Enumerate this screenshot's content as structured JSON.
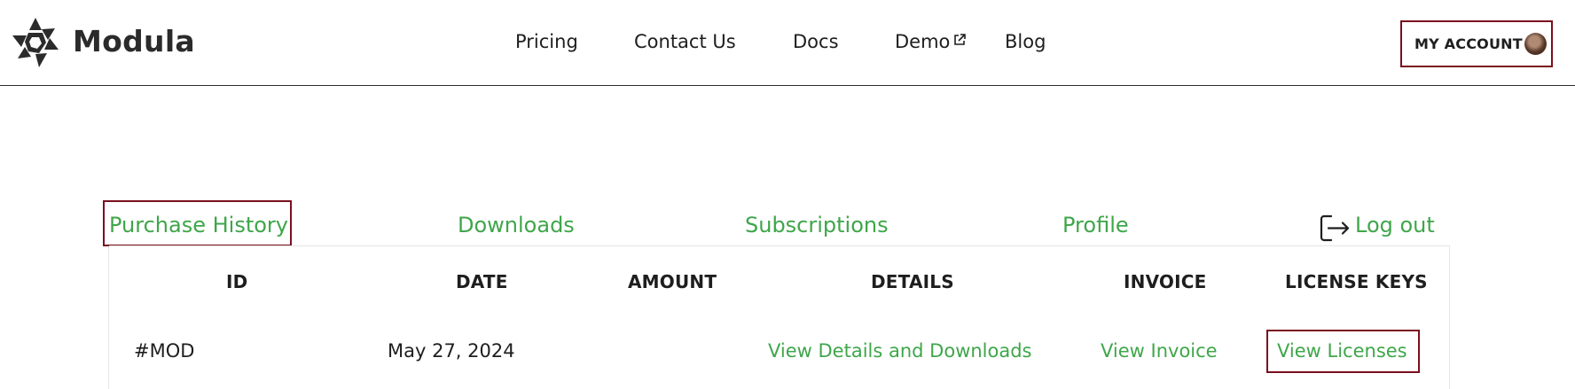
{
  "header": {
    "brand": "Modula",
    "nav": [
      {
        "label": "Pricing"
      },
      {
        "label": "Contact Us"
      },
      {
        "label": "Docs"
      },
      {
        "label": "Demo",
        "icon": "external-link-icon"
      },
      {
        "label": "Blog"
      }
    ],
    "account_label": "MY ACCOUNT"
  },
  "tabs": [
    {
      "label": "Purchase History",
      "active": true
    },
    {
      "label": "Downloads"
    },
    {
      "label": "Subscriptions"
    },
    {
      "label": "Profile"
    },
    {
      "label": "Log out",
      "icon": "logout-icon"
    }
  ],
  "table": {
    "columns": [
      "ID",
      "DATE",
      "AMOUNT",
      "DETAILS",
      "INVOICE",
      "LICENSE KEYS"
    ],
    "rows": [
      {
        "id": "#MOD",
        "date": "May 27, 2024",
        "amount": "",
        "details": "View Details and Downloads",
        "invoice": "View Invoice",
        "license_keys": "View Licenses"
      }
    ]
  },
  "colors": {
    "link_green": "#3fa64a",
    "highlight_frame": "#7a0f1f",
    "text": "#1e1e1e"
  }
}
